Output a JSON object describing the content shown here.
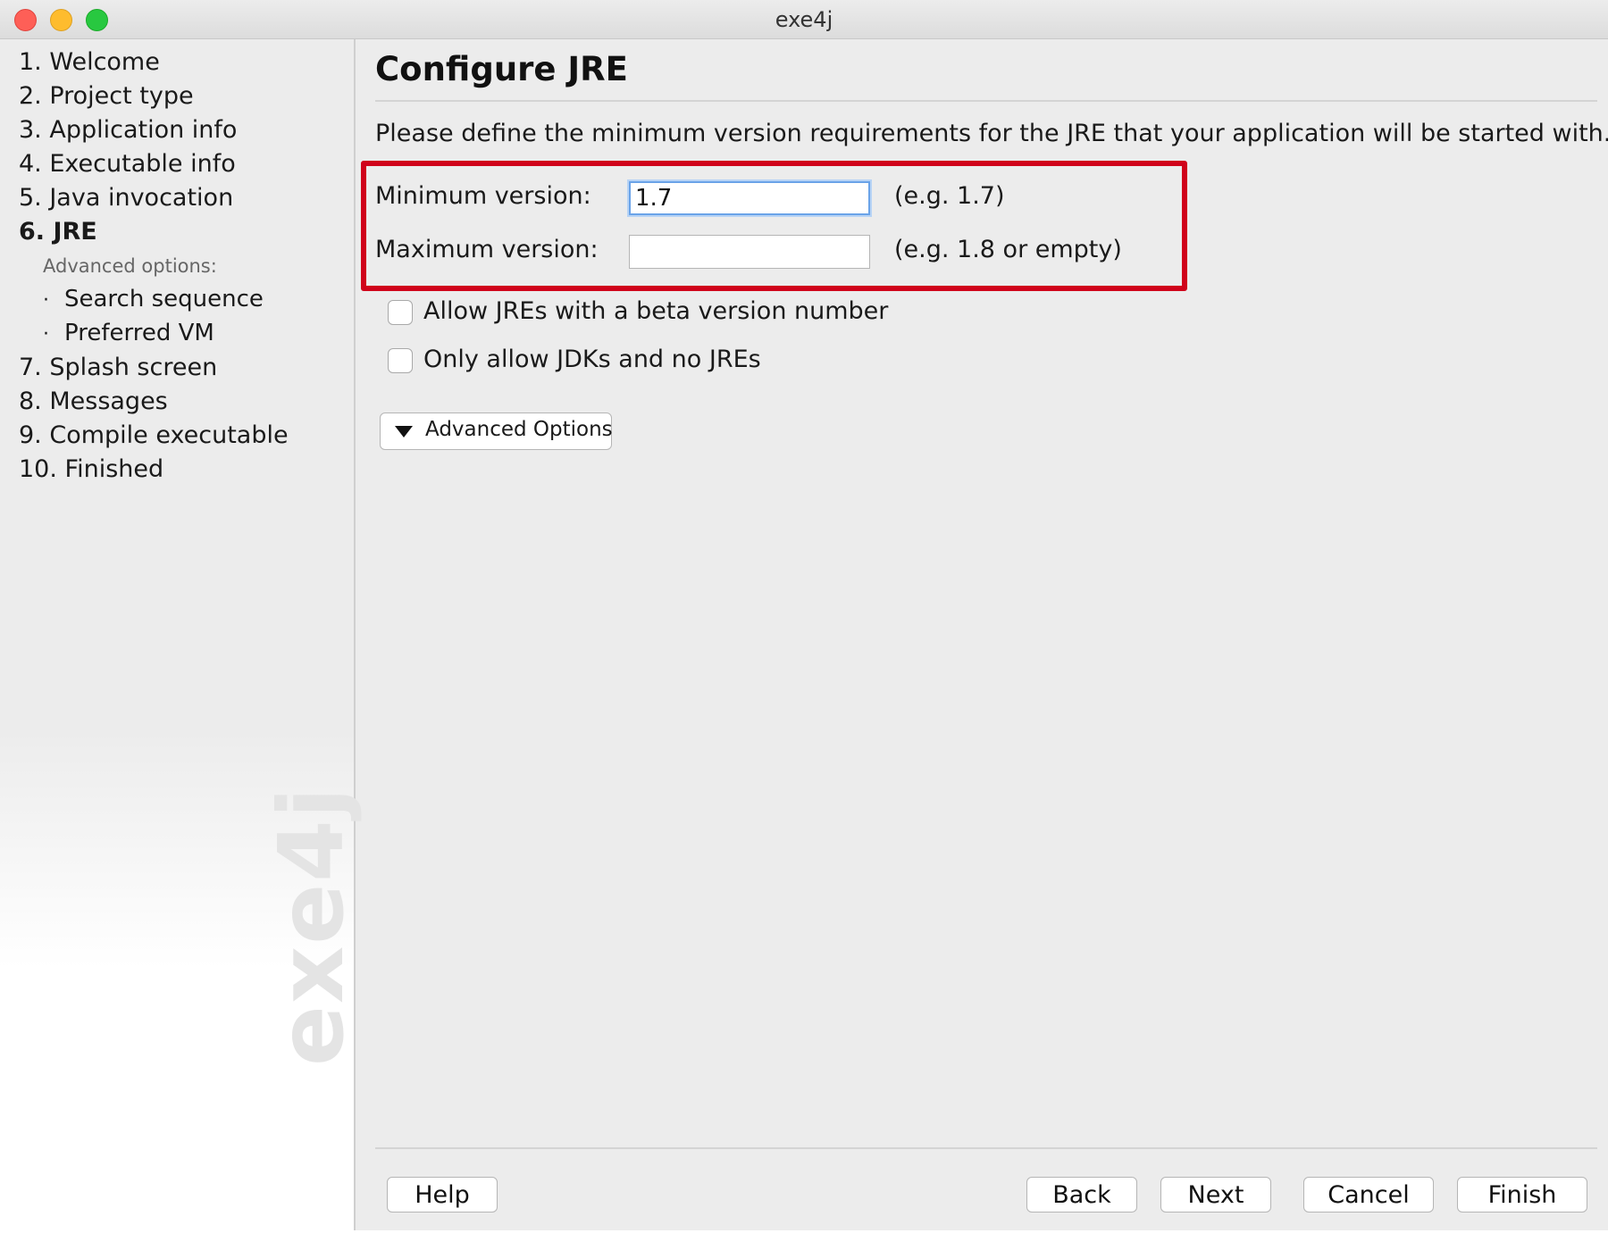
{
  "window": {
    "title": "exe4j"
  },
  "sidebar": {
    "steps": [
      {
        "label": "1. Welcome"
      },
      {
        "label": "2. Project type"
      },
      {
        "label": "3. Application info"
      },
      {
        "label": "4. Executable info"
      },
      {
        "label": "5. Java invocation"
      },
      {
        "label": "6. JRE",
        "active": true
      },
      {
        "label": "7. Splash screen"
      },
      {
        "label": "8. Messages"
      },
      {
        "label": "9. Compile executable"
      },
      {
        "label": "10. Finished"
      }
    ],
    "advanced_heading": "Advanced options:",
    "advanced_items": [
      {
        "label": "Search sequence"
      },
      {
        "label": "Preferred VM"
      }
    ],
    "bullet": "·",
    "watermark": "exe4j"
  },
  "main": {
    "title": "Configure JRE",
    "description": "Please define the minimum version requirements for the JRE that your application will be started with.",
    "min_version": {
      "label": "Minimum version:",
      "value": "1.7",
      "hint": "(e.g. 1.7)"
    },
    "max_version": {
      "label": "Maximum version:",
      "value": "",
      "hint": "(e.g. 1.8 or empty)"
    },
    "checkboxes": [
      {
        "label": "Allow JREs with a beta version number",
        "checked": false
      },
      {
        "label": "Only allow JDKs and no JREs",
        "checked": false
      }
    ],
    "advanced_options_label": "Advanced Options"
  },
  "buttons": {
    "help": "Help",
    "back": "Back",
    "next": "Next",
    "cancel": "Cancel",
    "finish": "Finish"
  },
  "colors": {
    "highlight": "#d0021b",
    "focus": "#6aa3e8",
    "background": "#ececec"
  }
}
